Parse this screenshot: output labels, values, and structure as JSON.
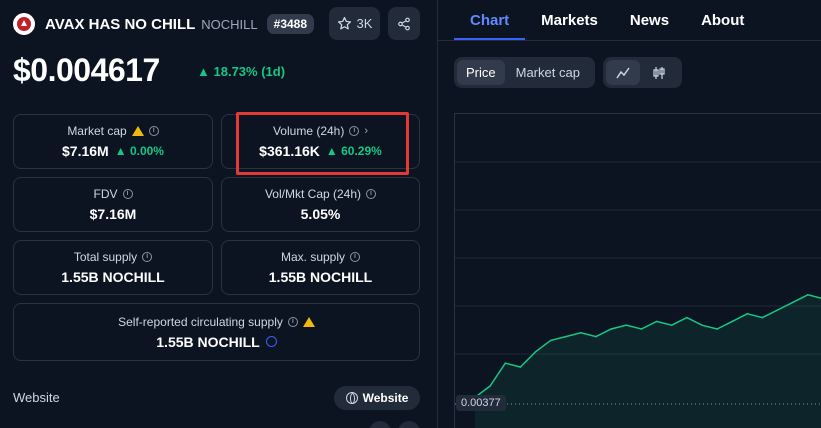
{
  "coin": {
    "name": "AVAX HAS NO CHILL",
    "symbol": "NOCHILL",
    "rank": "#3488",
    "watchlist_count": "3K",
    "price": "$0.004617",
    "price_change": "18.73% (1d)"
  },
  "stats": {
    "market_cap": {
      "label": "Market cap",
      "value": "$7.16M",
      "change": "0.00%"
    },
    "volume": {
      "label": "Volume (24h)",
      "value": "$361.16K",
      "change": "60.29%"
    },
    "fdv": {
      "label": "FDV",
      "value": "$7.16M"
    },
    "vol_mkt_cap": {
      "label": "Vol/Mkt Cap (24h)",
      "value": "5.05%"
    },
    "total_supply": {
      "label": "Total supply",
      "value": "1.55B NOCHILL"
    },
    "max_supply": {
      "label": "Max. supply",
      "value": "1.55B NOCHILL"
    },
    "circulating": {
      "label": "Self-reported circulating supply",
      "value": "1.55B NOCHILL"
    }
  },
  "links": {
    "website_label": "Website",
    "website_button": "Website"
  },
  "tabs": [
    "Chart",
    "Markets",
    "News",
    "About"
  ],
  "active_tab": "Chart",
  "chart_controls": {
    "price": "Price",
    "market_cap": "Market cap"
  },
  "colors": {
    "positive": "#16c784",
    "accent": "#3861fb",
    "highlight": "#e53935"
  },
  "chart_data": {
    "type": "line",
    "y_tick_labels": [
      "0.00377"
    ],
    "series": [
      {
        "values": [
          0.00377,
          0.0038,
          0.00386,
          0.00385,
          0.00389,
          0.00392,
          0.00393,
          0.00394,
          0.00393,
          0.00395,
          0.00396,
          0.00395,
          0.00397,
          0.00396,
          0.00398,
          0.00396,
          0.00395,
          0.00397,
          0.00399,
          0.00398,
          0.004,
          0.00402,
          0.00404,
          0.00403
        ]
      }
    ]
  }
}
